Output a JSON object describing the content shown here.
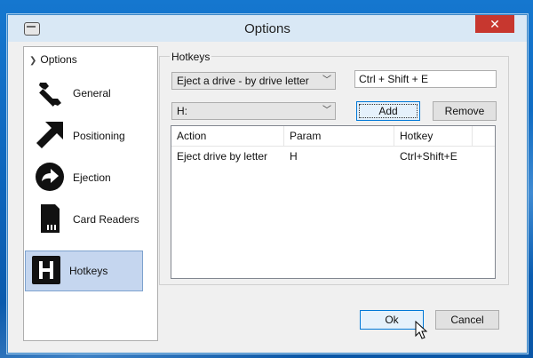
{
  "window": {
    "title": "Options",
    "close_glyph": "✕"
  },
  "sidebar": {
    "header": "Options",
    "items": [
      {
        "label": "General",
        "icon": "wrench-icon"
      },
      {
        "label": "Positioning",
        "icon": "arrow-icon"
      },
      {
        "label": "Ejection",
        "icon": "eject-arrow-icon"
      },
      {
        "label": "Card Readers",
        "icon": "sd-card-icon"
      },
      {
        "label": "Hotkeys",
        "icon": "hotkey-h-icon",
        "selected": true
      }
    ]
  },
  "hotkeys": {
    "group_title": "Hotkeys",
    "action_select": "Eject a drive - by drive letter",
    "hotkey_input": "Ctrl + Shift + E",
    "param_select": "H:",
    "add_label": "Add",
    "remove_label": "Remove",
    "columns": [
      "Action",
      "Param",
      "Hotkey"
    ],
    "rows": [
      {
        "action": "Eject drive by letter",
        "param": "H",
        "hotkey": "Ctrl+Shift+E"
      }
    ]
  },
  "footer": {
    "ok_label": "Ok",
    "cancel_label": "Cancel"
  },
  "colors": {
    "selection": "#c5d6ef",
    "close": "#c7372f",
    "desktop": "#0b62b8"
  }
}
